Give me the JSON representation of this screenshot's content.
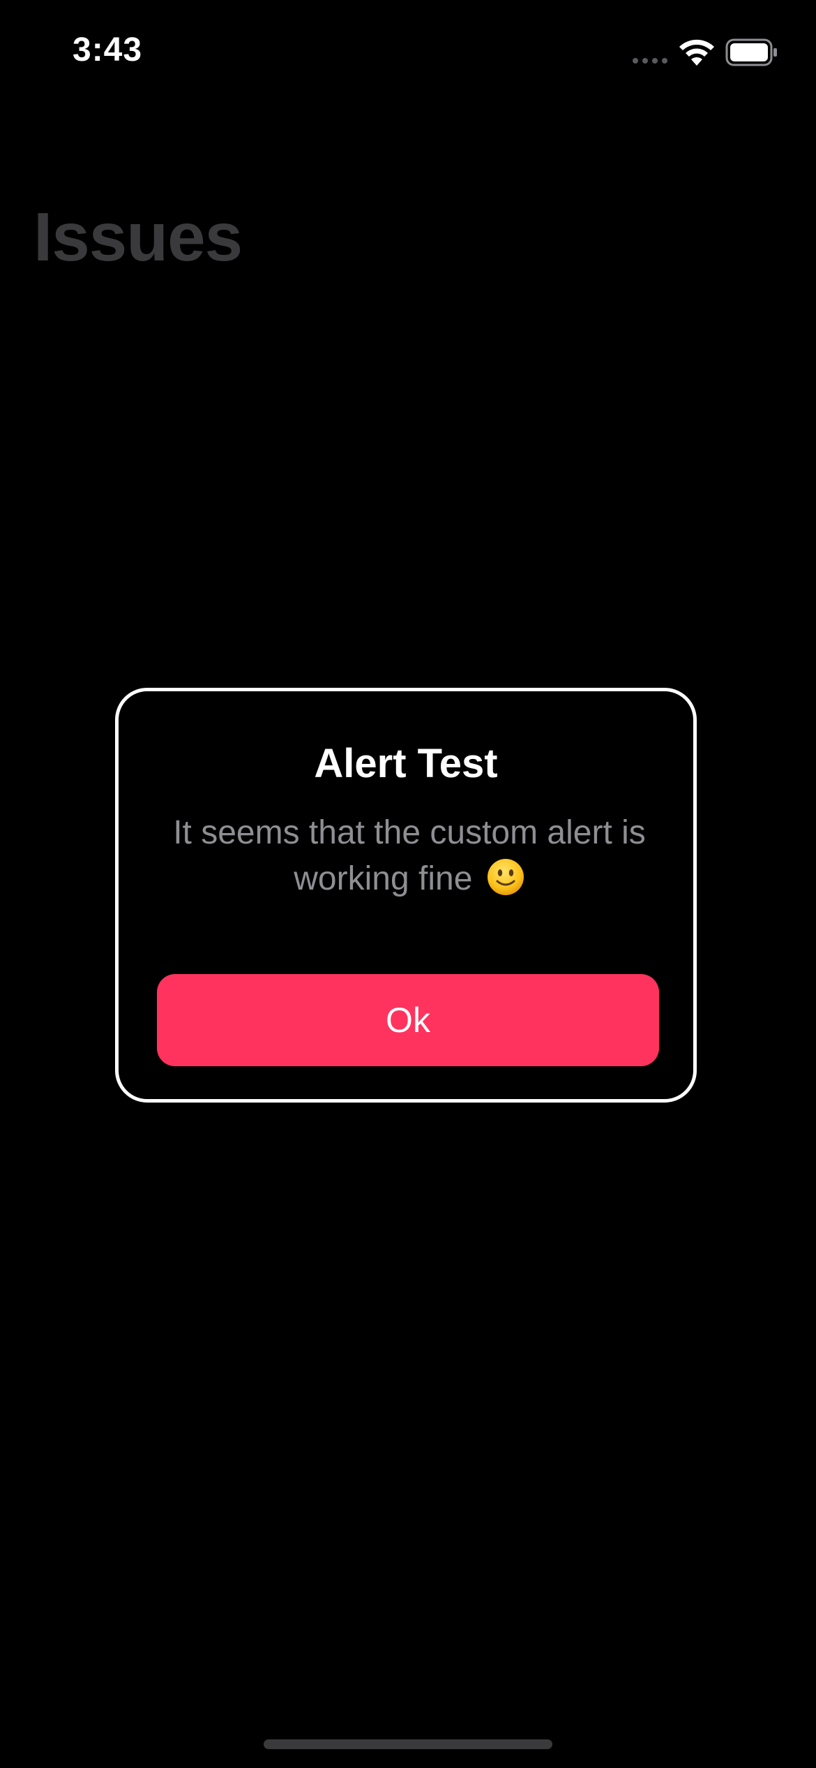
{
  "status_bar": {
    "time": "3:43",
    "icons": [
      "cellular-signal-icon",
      "wifi-icon",
      "battery-icon"
    ]
  },
  "page": {
    "title": "Issues"
  },
  "alert": {
    "title": "Alert Test",
    "message": "It seems that the custom alert is working fine",
    "emoji_icon": "slightly-smiling-face-icon",
    "ok_label": "Ok"
  },
  "colors": {
    "background": "#000000",
    "accent": "#ff335e",
    "title_dimmed": "#3a3a3c",
    "message_text": "#8e8e93",
    "card_border": "#ffffff"
  }
}
